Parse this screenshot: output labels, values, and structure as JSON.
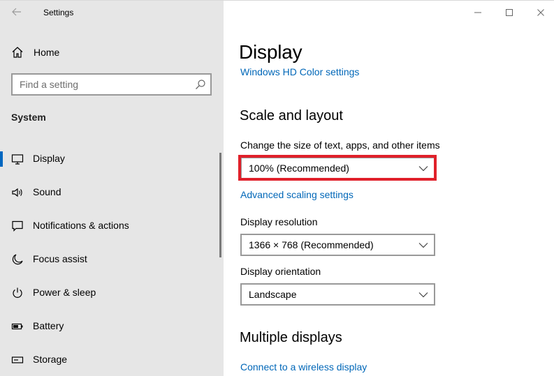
{
  "window": {
    "app_title": "Settings",
    "controls": [
      "minimize",
      "maximize",
      "close"
    ]
  },
  "sidebar": {
    "home_label": "Home",
    "search_placeholder": "Find a setting",
    "section_title": "System",
    "items": [
      {
        "label": "Display",
        "icon": "monitor-icon",
        "active": true
      },
      {
        "label": "Sound",
        "icon": "speaker-icon",
        "active": false
      },
      {
        "label": "Notifications & actions",
        "icon": "message-icon",
        "active": false
      },
      {
        "label": "Focus assist",
        "icon": "moon-icon",
        "active": false
      },
      {
        "label": "Power & sleep",
        "icon": "power-icon",
        "active": false
      },
      {
        "label": "Battery",
        "icon": "battery-icon",
        "active": false
      },
      {
        "label": "Storage",
        "icon": "storage-icon",
        "active": false
      }
    ]
  },
  "main": {
    "title": "Display",
    "hd_color_link": "Windows HD Color settings",
    "scale_heading": "Scale and layout",
    "scale_label": "Change the size of text, apps, and other items",
    "scale_value": "100% (Recommended)",
    "advanced_link": "Advanced scaling settings",
    "resolution_label": "Display resolution",
    "resolution_value": "1366 × 768 (Recommended)",
    "orientation_label": "Display orientation",
    "orientation_value": "Landscape",
    "multiple_heading": "Multiple displays",
    "wireless_link": "Connect to a wireless display"
  },
  "colors": {
    "accent": "#0067c0",
    "link": "#0067b8",
    "highlight_border": "#e0202a",
    "sidebar_bg": "#e6e6e6"
  }
}
